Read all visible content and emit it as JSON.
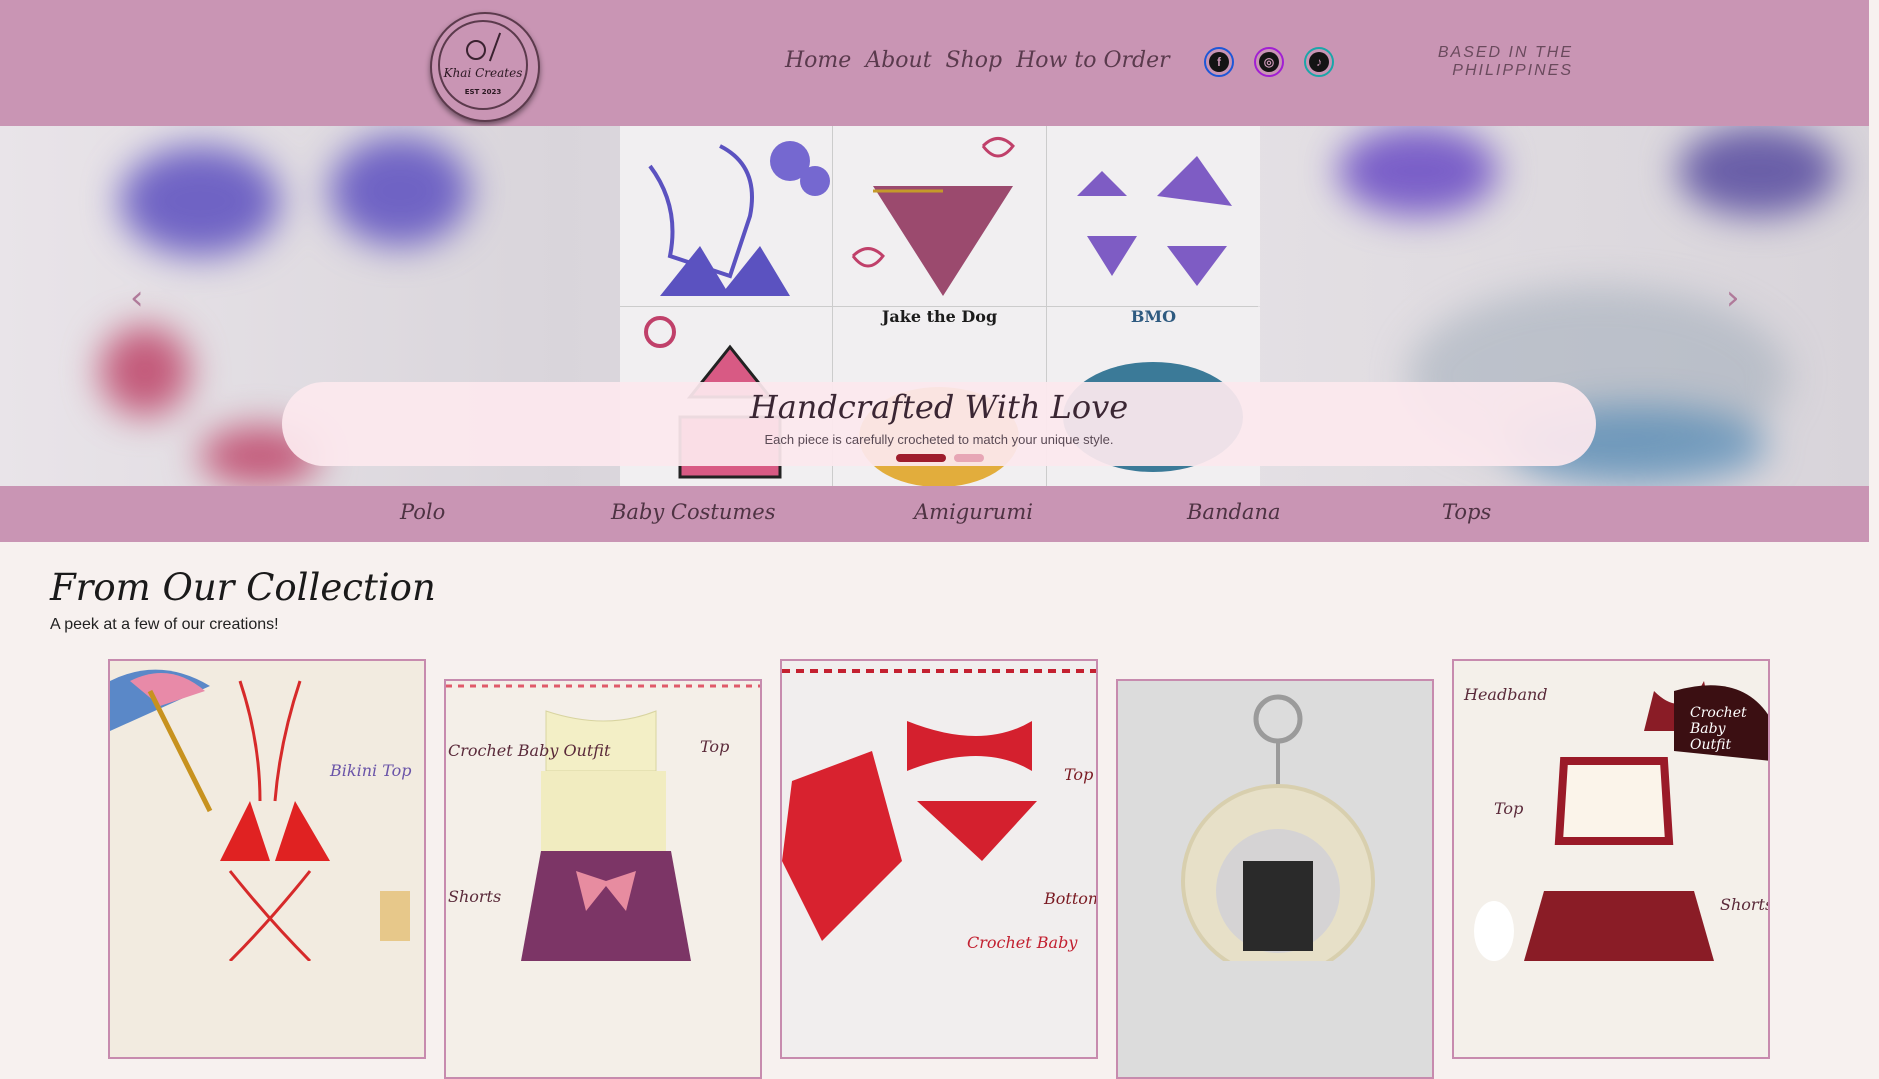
{
  "header": {
    "logo_name": "Khai Creates",
    "logo_est": "EST 2023",
    "nav": [
      "Home",
      "About",
      "Shop",
      "How to Order"
    ],
    "social": [
      {
        "name": "facebook-icon",
        "glyph": "f"
      },
      {
        "name": "instagram-icon",
        "glyph": "◎"
      },
      {
        "name": "tiktok-icon",
        "glyph": "♪"
      }
    ],
    "based_line1": "BASED IN THE",
    "based_line2": "PHILIPPINES"
  },
  "hero": {
    "title": "Handcrafted With Love",
    "subtitle": "Each piece is carefully crocheted to match your unique style.",
    "prev_arrow": "‹",
    "next_arrow": "›",
    "tiles": [
      "",
      "",
      "",
      "",
      "Jake the Dog",
      "BMO"
    ],
    "active_slide": 1,
    "slide_count": 2
  },
  "categories": [
    "Polo",
    "Baby Costumes",
    "Amigurumi",
    "Bandana",
    "Tops"
  ],
  "collection": {
    "title": "From Our Collection",
    "subtitle": "A peek at a few of our creations!",
    "cards": [
      {
        "labels": [
          "Bikini Top"
        ]
      },
      {
        "labels": [
          "Crochet Baby Outfit",
          "Top",
          "Shorts"
        ]
      },
      {
        "labels": [
          "Top",
          "Bottom",
          "Crochet Baby"
        ]
      },
      {
        "labels": []
      },
      {
        "labels": [
          "Headband",
          "Crochet Baby Outfit",
          "Top",
          "Shorts"
        ]
      }
    ]
  },
  "colors": {
    "header_bg": "#c995b4",
    "page_bg": "#f7f1ef",
    "accent": "#9e1c2c"
  }
}
